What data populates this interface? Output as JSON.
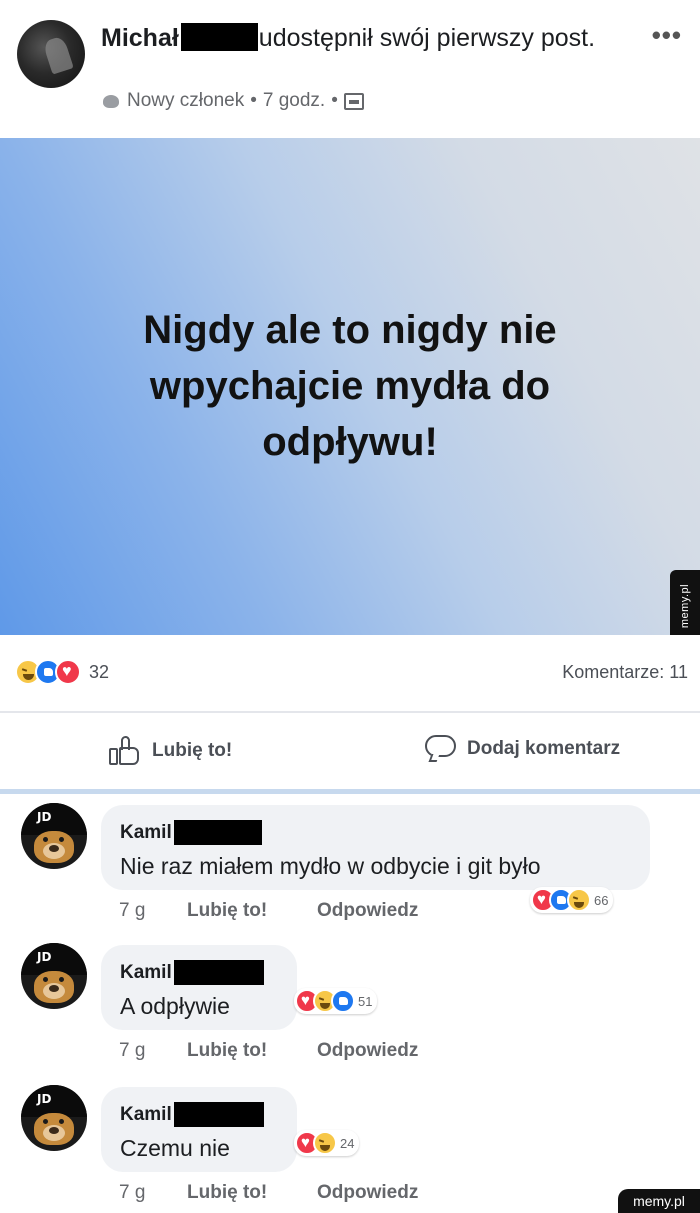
{
  "post": {
    "author": "Michał",
    "action_text": "udostępnił swój pierwszy post.",
    "badge": "Nowy członek",
    "time": "7 godz.",
    "separator": "•",
    "more": "•••",
    "image_text": "Nigdy ale to nigdy nie wpychajcie mydła do odpływu!",
    "reaction_count": "32",
    "comments_label": "Komentarze: 11"
  },
  "actions": {
    "like_label": "Lubię to!",
    "comment_label": "Dodaj komentarz"
  },
  "comments": [
    {
      "name": "Kamil",
      "text": "Nie raz miałem mydło w odbycie i git było",
      "time": "7 g",
      "like": "Lubię to!",
      "reply": "Odpowiedz",
      "reaction_count": "66"
    },
    {
      "name": "Kamil",
      "text": "A odpływie",
      "time": "7 g",
      "like": "Lubię to!",
      "reply": "Odpowiedz",
      "reaction_count": "51"
    },
    {
      "name": "Kamil",
      "text": "Czemu nie",
      "time": "7 g",
      "like": "Lubię to!",
      "reply": "Odpowiedz",
      "reaction_count": "24"
    }
  ],
  "avatar_label": "JD",
  "watermark": "memy.pl",
  "colors": {
    "like_blue": "#1e78f0",
    "love_red": "#f0384a",
    "haha_yellow": "#f7c748",
    "bubble_gray": "#f0f2f5"
  }
}
